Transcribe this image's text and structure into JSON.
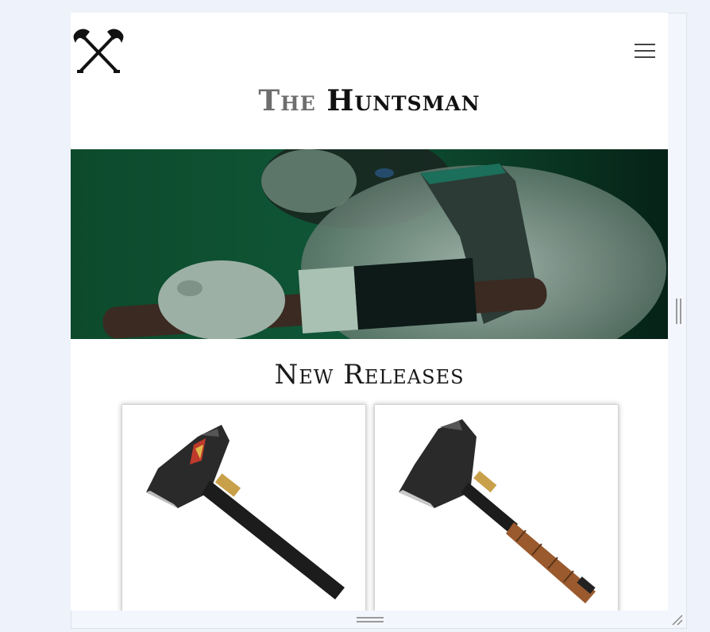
{
  "site": {
    "title_part1": "The",
    "title_part2": "Huntsman",
    "logo_icon": "crossed-axes-icon",
    "menu_icon": "hamburger-menu-icon"
  },
  "hero": {
    "image": "hero-warrior-with-axe"
  },
  "new_releases": {
    "heading": "New Releases",
    "products": [
      {
        "image": "black-handle-hatchet"
      },
      {
        "image": "leather-handle-hatchet"
      }
    ]
  },
  "colors": {
    "accent_green": "#0d4a2c",
    "title_gray": "#6e6e6e",
    "title_dark": "#111111"
  }
}
